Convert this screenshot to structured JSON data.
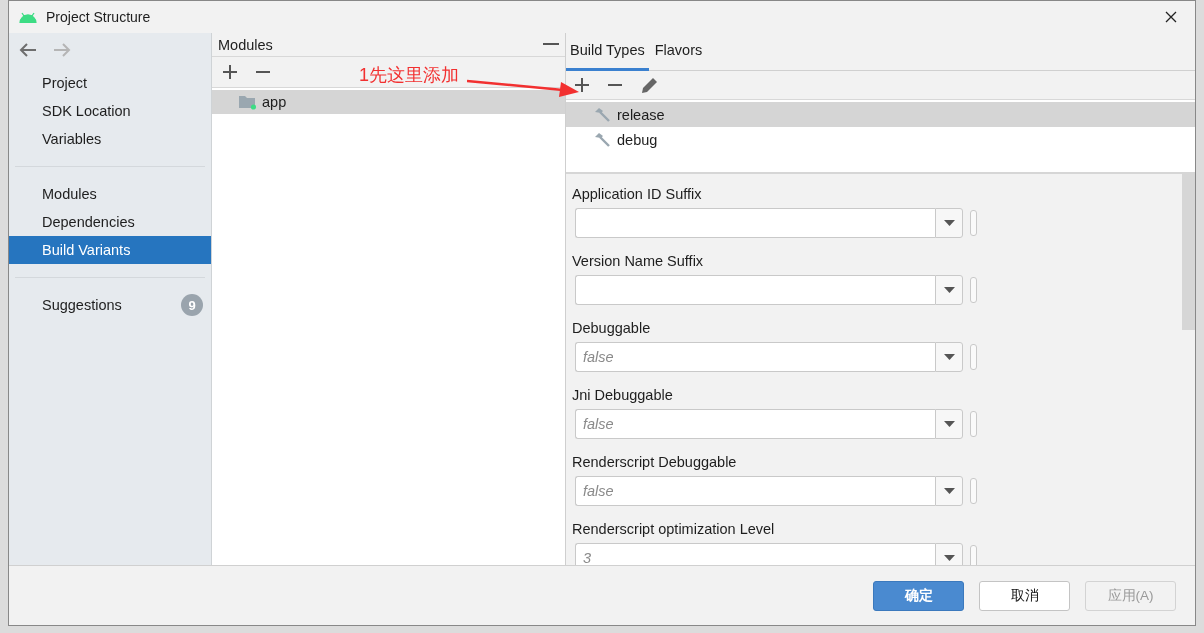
{
  "window": {
    "title": "Project Structure"
  },
  "navigation": [
    {
      "kind": "back",
      "disabled": false
    },
    {
      "kind": "forward",
      "disabled": true
    }
  ],
  "sidebar": {
    "groups": [
      [
        {
          "label": "Project",
          "selected": false
        },
        {
          "label": "SDK Location",
          "selected": false
        },
        {
          "label": "Variables",
          "selected": false
        }
      ],
      [
        {
          "label": "Modules",
          "selected": false
        },
        {
          "label": "Dependencies",
          "selected": false
        },
        {
          "label": "Build Variants",
          "selected": true
        }
      ],
      [
        {
          "label": "Suggestions",
          "selected": false,
          "badge": "9"
        }
      ]
    ]
  },
  "modules_panel": {
    "title": "Modules",
    "modules": [
      {
        "name": "app",
        "selected": true
      }
    ]
  },
  "build_panel": {
    "tabs": [
      {
        "label": "Build Types",
        "selected": true
      },
      {
        "label": "Flavors",
        "selected": false
      }
    ],
    "build_types": [
      {
        "name": "release",
        "selected": true
      },
      {
        "name": "debug",
        "selected": false
      }
    ],
    "fields": [
      {
        "label": "Application ID Suffix"
      },
      {
        "label": "Version Name Suffix"
      },
      {
        "label": "Debuggable",
        "placeholder": "false"
      },
      {
        "label": "Jni Debuggable",
        "placeholder": "false"
      },
      {
        "label": "Renderscript Debuggable",
        "placeholder": "false"
      },
      {
        "label": "Renderscript optimization Level",
        "placeholder": "3"
      }
    ]
  },
  "annotation": {
    "text": "1先这里添加"
  },
  "buttons": [
    {
      "label": "确定",
      "kind": "primary",
      "disabled": false
    },
    {
      "label": "取消",
      "kind": "default",
      "disabled": false
    },
    {
      "label": "应用(A)",
      "kind": "default",
      "disabled": true
    }
  ]
}
